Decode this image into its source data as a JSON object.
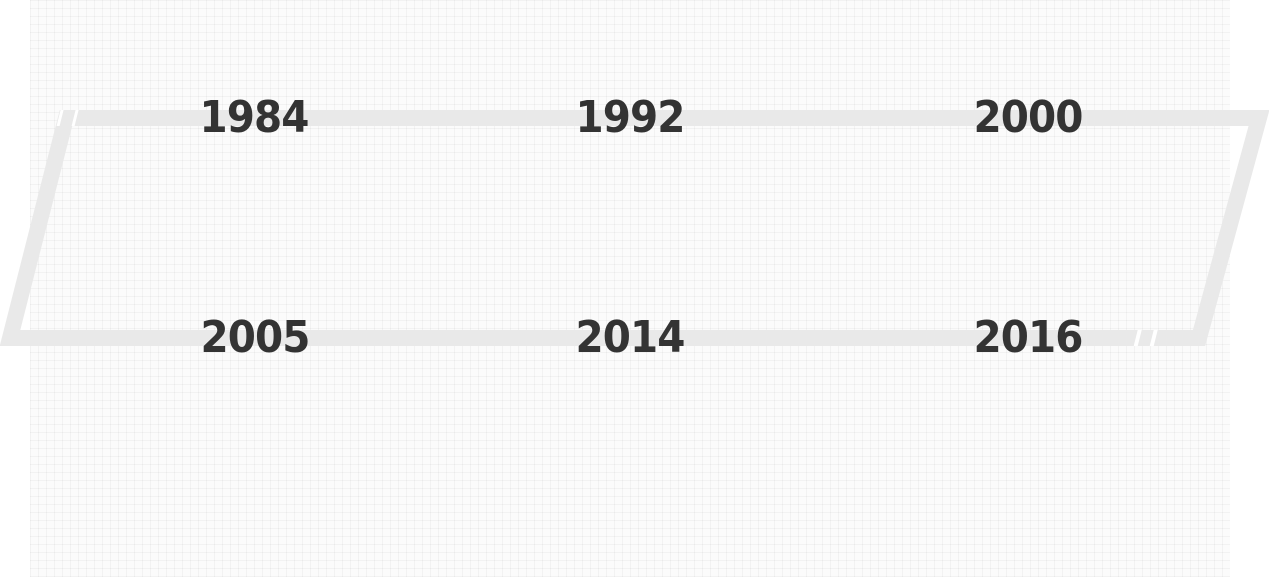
{
  "timeline": {
    "years": [
      "1984",
      "1992",
      "2000",
      "2005",
      "2014",
      "2016"
    ]
  },
  "colors": {
    "frame": "#e9e9e9",
    "text": "#333333",
    "grid": "#f2f2f2"
  }
}
